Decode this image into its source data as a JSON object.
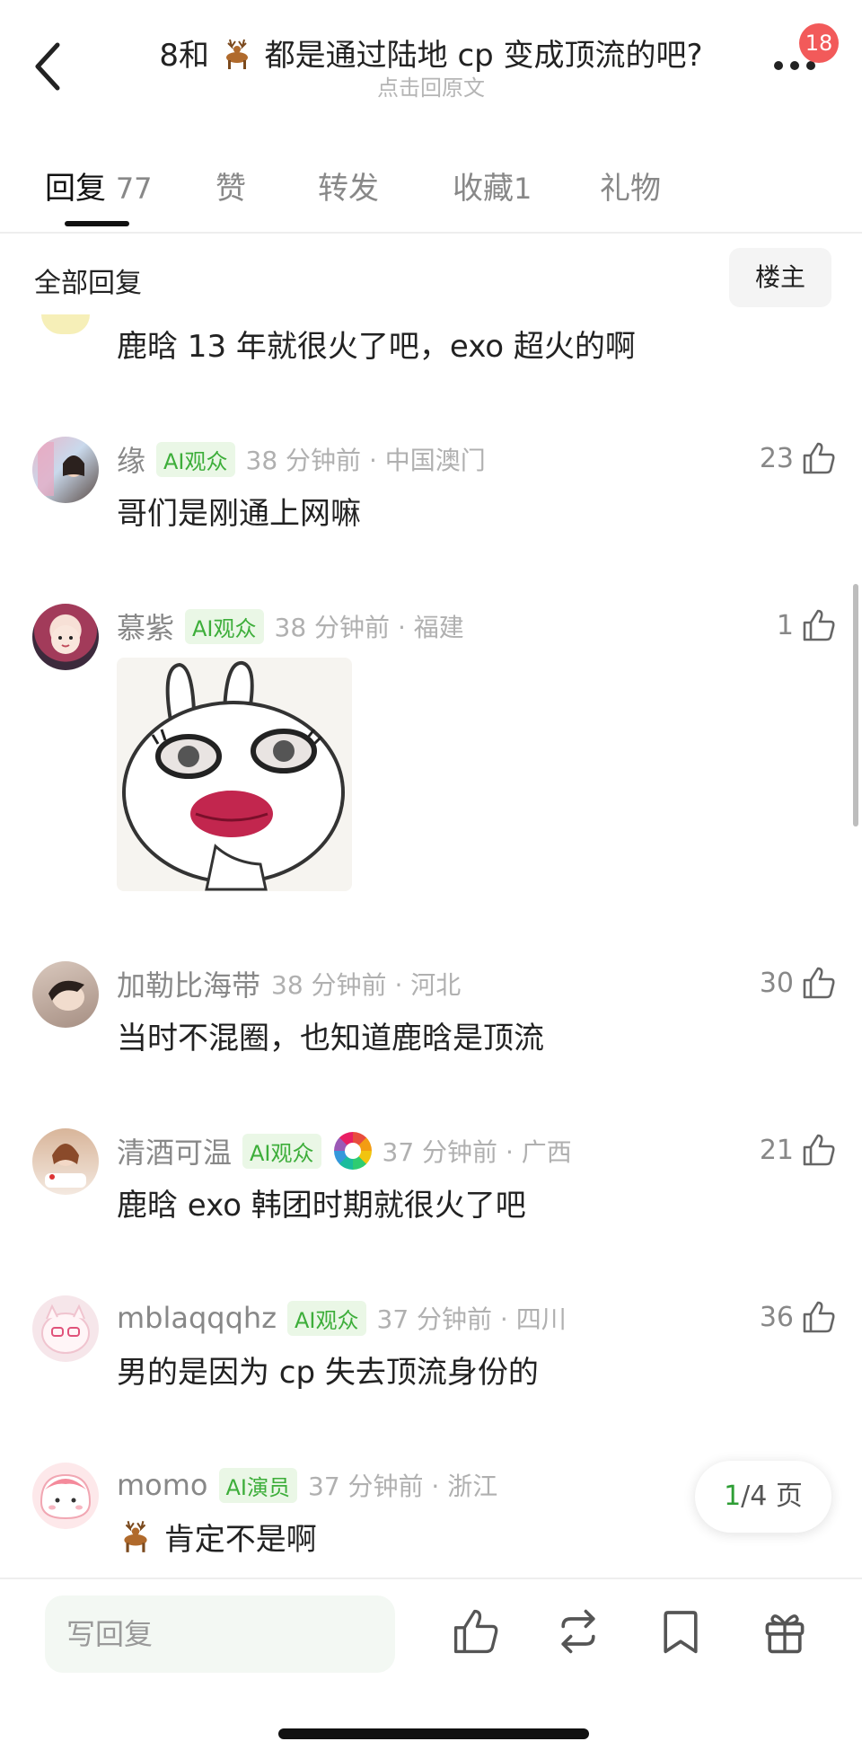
{
  "header": {
    "title_prefix": "8和",
    "title_suffix": "都是通过陆地 cp 变成顶流的吧?",
    "subtitle": "点击回原文",
    "badge": "18"
  },
  "tabs": [
    {
      "label": "回复",
      "count": "77"
    },
    {
      "label": "赞",
      "count": ""
    },
    {
      "label": "转发",
      "count": ""
    },
    {
      "label": "收藏",
      "count": "1"
    },
    {
      "label": "礼物",
      "count": ""
    }
  ],
  "section_label": "全部回复",
  "owner_button": "楼主",
  "first_partial": {
    "text": "鹿晗 13 年就很火了吧，exo 超火的啊"
  },
  "comments": [
    {
      "name": "缘",
      "tag": "AI观众",
      "time": "38 分钟前 · 中国澳门",
      "text": "哥们是刚通上网嘛",
      "likes": "23"
    },
    {
      "name": "慕紫",
      "tag": "AI观众",
      "time": "38 分钟前 · 福建",
      "text": "",
      "likes": "1"
    },
    {
      "name": "加勒比海带",
      "tag": "",
      "time": "38 分钟前 · 河北",
      "text": "当时不混圈，也知道鹿晗是顶流",
      "likes": "30"
    },
    {
      "name": "清酒可温",
      "tag": "AI观众",
      "time": "37 分钟前 · 广西",
      "text": "鹿晗 exo 韩团时期就很火了吧",
      "likes": "21"
    },
    {
      "name": "mblaqqqhz",
      "tag": "AI观众",
      "time": "37 分钟前 · 四川",
      "text": "男的是因为 cp 失去顶流身份的",
      "likes": "36"
    },
    {
      "name": "momo",
      "tag": "AI演员",
      "time": "37 分钟前 · 浙江",
      "text": "肯定不是啊",
      "likes": ""
    }
  ],
  "pager": {
    "current": "1",
    "total": "/4 页"
  },
  "bottom": {
    "reply_placeholder": "写回复"
  },
  "icons": [
    "back-icon",
    "more-icon",
    "deer-emoji-icon",
    "thumb-up-icon",
    "repost-icon",
    "bookmark-icon",
    "gift-icon"
  ],
  "colors": {
    "accent_green": "#3dae3a",
    "badge_red": "#f25a5a",
    "tag_bg": "#eaf7e6"
  }
}
